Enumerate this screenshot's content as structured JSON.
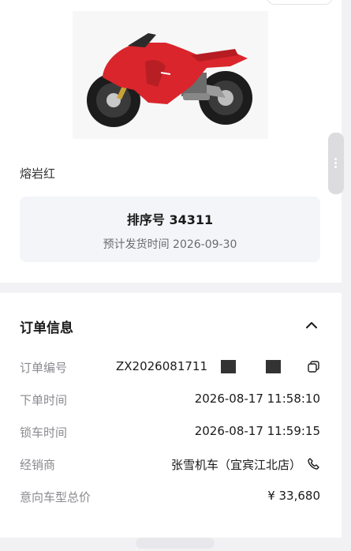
{
  "product": {
    "color_name": "熔岩红",
    "image_icon": "motorcycle-image"
  },
  "queue": {
    "title": "排序号 34311",
    "delivery": "预计发货时间 2026-09-30"
  },
  "order_info": {
    "title": "订单信息",
    "rows": [
      {
        "label": "订单编号",
        "value": "ZX2026081711"
      },
      {
        "label": "下单时间",
        "value": "2026-08-17 11:58:10"
      },
      {
        "label": "锁车时间",
        "value": "2026-08-17 11:59:15"
      },
      {
        "label": "经销商",
        "value": "张雪机车（宜宾江北店）"
      },
      {
        "label": "意向车型总价",
        "value": "¥ 33,680"
      }
    ]
  },
  "colors": {
    "accent_red": "#d9252b",
    "label_gray": "#8a8a90",
    "panel_bg": "#f4f5f9"
  }
}
